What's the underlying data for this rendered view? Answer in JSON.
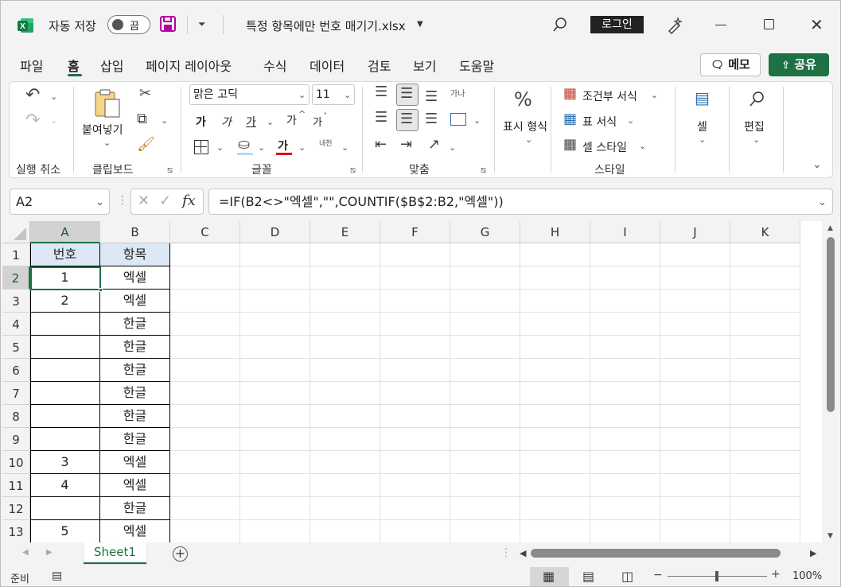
{
  "window": {
    "autosave_label": "자동 저장",
    "autosave_state": "끔",
    "file_title": "특정 항목에만 번호 매기기.xlsx",
    "login_label": "로그인"
  },
  "menu": {
    "tabs": [
      "파일",
      "홈",
      "삽입",
      "페이지 레이아웃",
      "수식",
      "데이터",
      "검토",
      "보기",
      "도움말"
    ],
    "active_tab": "홈",
    "memo_label": "메모",
    "share_label": "공유"
  },
  "ribbon": {
    "paste_label": "붙여넣기",
    "font_name": "맑은 고딕",
    "font_size": "11",
    "font_bold": "가",
    "font_italic": "가",
    "font_underline": "가",
    "font_grow": "가",
    "font_shrink": "가",
    "font_color_glyph": "가",
    "phonetic_glyph": "내천",
    "wrap_glyph": "가나",
    "number_format_label": "표시 형식",
    "conditional_format_label": "조건부 서식",
    "table_format_label": "표 서식",
    "cell_style_label": "셀 스타일",
    "cells_label": "셀",
    "edit_label": "편집",
    "groups": {
      "undo": "실행 취소",
      "clipboard": "클립보드",
      "font": "글꼴",
      "alignment": "맞춤",
      "style": "스타일"
    }
  },
  "formula_bar": {
    "name_box": "A2",
    "formula": "=IF(B2<>\"엑셀\",\"\",COUNTIF($B$2:B2,\"엑셀\"))"
  },
  "sheet": {
    "columns": [
      "A",
      "B",
      "C",
      "D",
      "E",
      "F",
      "G",
      "H",
      "I",
      "J",
      "K"
    ],
    "rows": [
      "1",
      "2",
      "3",
      "4",
      "5",
      "6",
      "7",
      "8",
      "9",
      "10",
      "11",
      "12",
      "13"
    ],
    "header": [
      "번호",
      "항목"
    ],
    "data": [
      [
        "1",
        "엑셀"
      ],
      [
        "2",
        "엑셀"
      ],
      [
        "",
        "한글"
      ],
      [
        "",
        "한글"
      ],
      [
        "",
        "한글"
      ],
      [
        "",
        "한글"
      ],
      [
        "",
        "한글"
      ],
      [
        "",
        "한글"
      ],
      [
        "3",
        "엑셀"
      ],
      [
        "4",
        "엑셀"
      ],
      [
        "",
        "한글"
      ],
      [
        "5",
        "엑셀"
      ]
    ],
    "active_cell": "A2",
    "tab_name": "Sheet1"
  },
  "status_bar": {
    "ready": "준비",
    "zoom": "100%"
  },
  "colors": {
    "accent": "#1e7145",
    "header_fill": "#dde8f6"
  }
}
